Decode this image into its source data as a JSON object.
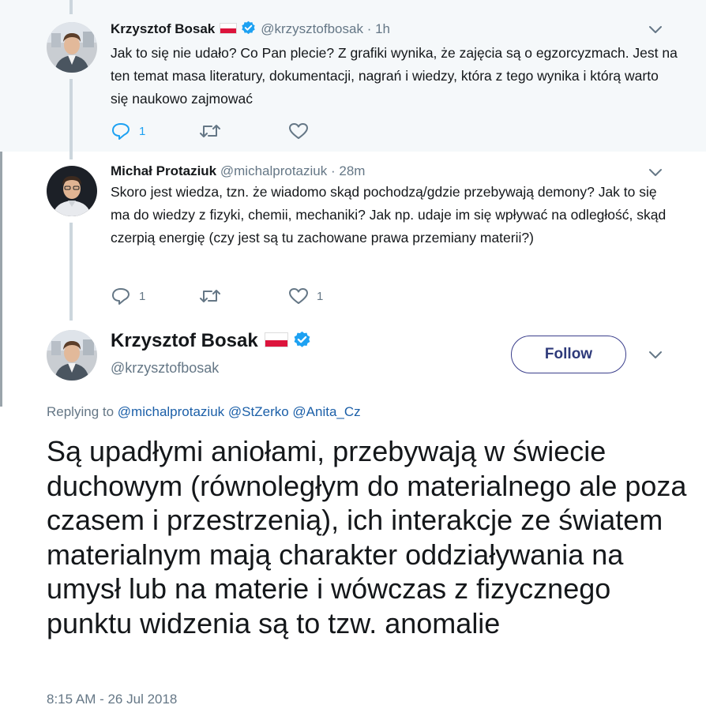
{
  "tweets": [
    {
      "name": "Krzysztof Bosak",
      "handle": "@krzysztofbosak",
      "time": "· 1h",
      "text": "Jak to się nie udało? Co Pan plecie? Z grafiki wynika, że zajęcia są o egzorcyzmach. Jest na ten temat masa literatury, dokumentacji, nagrań i wiedzy, która z tego wynika i którą warto się naukowo zajmować",
      "reply_count": "1",
      "retweet_count": "",
      "like_count": ""
    },
    {
      "name": "Michał Protaziuk",
      "handle": "@michalprotaziuk",
      "time": "· 28m",
      "text": "Skoro jest wiedza, tzn. że wiadomo skąd pochodzą/gdzie przebywają demony? Jak to się ma do wiedzy z fizyki, chemii, mechaniki? Jak np. udaje im się wpływać na odległość, skąd czerpią energię (czy jest są tu zachowane prawa przemiany materii?)",
      "reply_count": "1",
      "retweet_count": "",
      "like_count": "1"
    }
  ],
  "main_tweet": {
    "name": "Krzysztof Bosak",
    "handle": "@krzysztofbosak",
    "follow_label": "Follow",
    "replying_prefix": "Replying to",
    "mentions": [
      "@michalprotaziuk",
      "@StZerko",
      "@Anita_Cz"
    ],
    "text": "Są upadłymi aniołami, przebywają w świecie duchowym (równoległym do materialnego ale poza czasem i przestrzenią), ich interakcje ze światem materialnym mają charakter oddziaływania na umysł lub na materie i wówczas z fizycznego punktu widzenia są to tzw. anomalie",
    "timestamp": "8:15 AM - 26 Jul 2018"
  },
  "colors": {
    "accent": "#1da1f2",
    "verified": "#1da1f2",
    "follow_border": "#3b3f8c",
    "muted": "#657786",
    "grey_background": "#f5f8fa"
  },
  "icons": [
    "verified-badge-icon",
    "poland-flag-icon",
    "chevron-down-icon",
    "reply-icon",
    "retweet-icon",
    "like-icon"
  ]
}
